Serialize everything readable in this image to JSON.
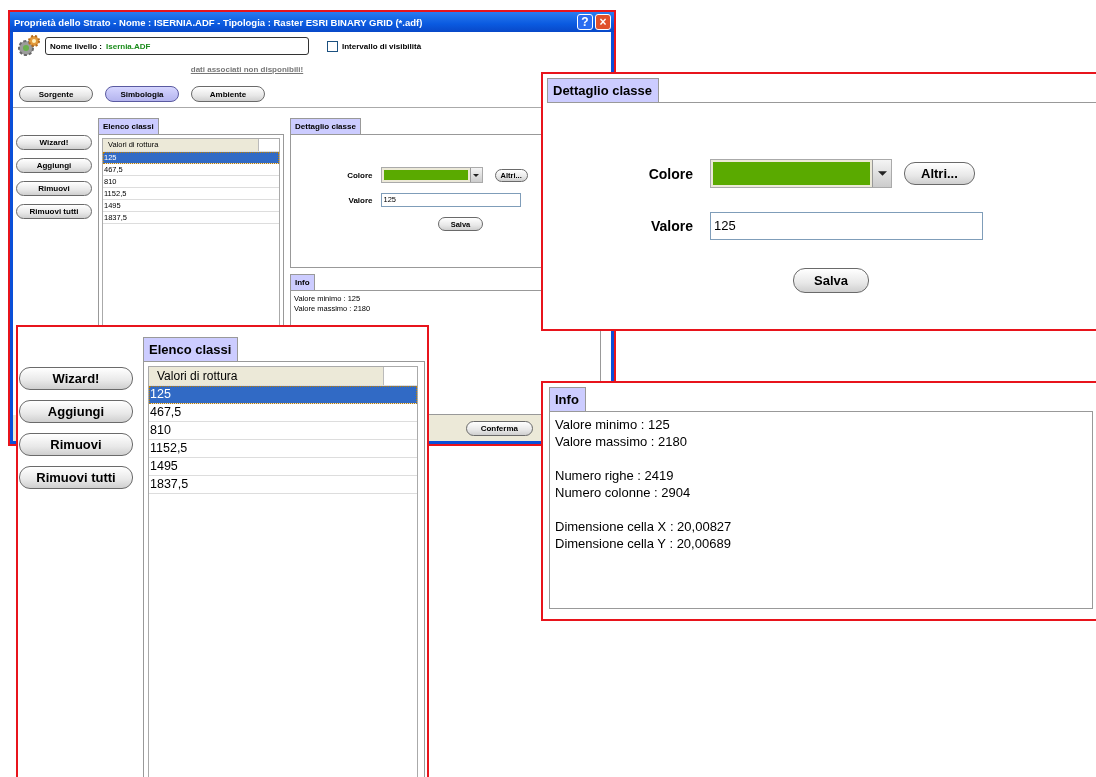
{
  "window": {
    "title": "Proprietà dello Strato - Nome : ISERNIA.ADF - Tipologia : Raster ESRI BINARY GRID (*.adf)",
    "title_buttons": [
      "?",
      "×"
    ],
    "layer_name_label": "Nome livello :",
    "layer_name_value": "Isernia.ADF",
    "visibility": {
      "label": "Intervallo di visibilità",
      "checked": false
    },
    "link": "dati associati non disponibili!",
    "tabs": [
      {
        "label": "Sorgente",
        "selected": false
      },
      {
        "label": "Simbologia",
        "selected": true
      },
      {
        "label": "Ambiente",
        "selected": false
      }
    ],
    "side_buttons": [
      "Wizard!",
      "Aggiungi",
      "Rimuovi",
      "Rimuovi tutti"
    ],
    "class_list": {
      "tab": "Elenco classi",
      "column_header": "Valori di rottura",
      "rows": [
        {
          "value": "125",
          "selected": true
        },
        {
          "value": "467,5",
          "selected": false
        },
        {
          "value": "810",
          "selected": false
        },
        {
          "value": "1152,5",
          "selected": false
        },
        {
          "value": "1495",
          "selected": false
        },
        {
          "value": "1837,5",
          "selected": false
        }
      ]
    },
    "detail": {
      "tab": "Dettaglio classe",
      "color_label": "Colore",
      "more_button": "Altri...",
      "value_label": "Valore",
      "value": "125",
      "save_button": "Salva"
    },
    "info": {
      "tab": "Info",
      "lines": [
        "Valore minimo : 125",
        "Valore massimo : 2180"
      ]
    },
    "footer_buttons": [
      "Conferma"
    ]
  },
  "class_list_zoom": {
    "side_buttons": [
      "Wizard!",
      "Aggiungi",
      "Rimuovi",
      "Rimuovi tutti"
    ],
    "tab": "Elenco classi",
    "column_header": "Valori di rottura",
    "rows": [
      {
        "value": "125",
        "selected": true
      },
      {
        "value": "467,5",
        "selected": false
      },
      {
        "value": "810",
        "selected": false
      },
      {
        "value": "1152,5",
        "selected": false
      },
      {
        "value": "1495",
        "selected": false
      },
      {
        "value": "1837,5",
        "selected": false
      }
    ]
  },
  "detail_zoom": {
    "tab": "Dettaglio classe",
    "color_label": "Colore",
    "more_button": "Altri...",
    "value_label": "Valore",
    "value": "125",
    "save_button": "Salva"
  },
  "info_zoom": {
    "tab": "Info",
    "groups": [
      [
        "Valore minimo : 125",
        "Valore massimo : 2180"
      ],
      [
        "Numero righe : 2419",
        "Numero colonne : 2904"
      ],
      [
        "Dimensione cella X : 20,00827",
        "Dimensione cella Y : 20,00689"
      ]
    ]
  }
}
